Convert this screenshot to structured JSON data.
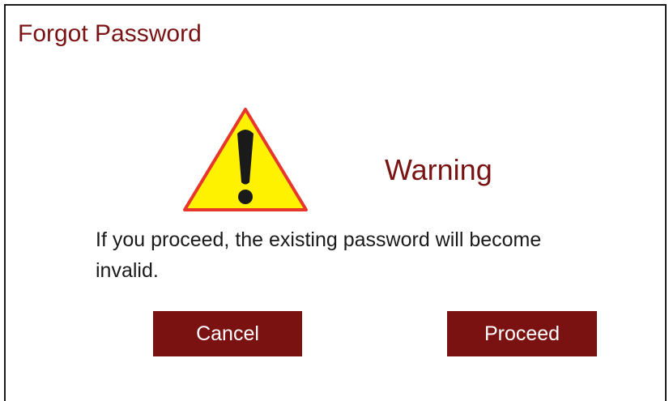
{
  "dialog": {
    "title": "Forgot Password",
    "warning_icon": "warning-triangle-icon",
    "heading": "Warning",
    "message": "If you proceed, the existing password will become invalid.",
    "buttons": {
      "cancel_label": "Cancel",
      "proceed_label": "Proceed"
    }
  },
  "colors": {
    "title_text": "#7a1414",
    "button_bg": "#7b1212",
    "button_text": "#ffffff",
    "icon_fill": "#fff200",
    "icon_outline": "#e8362c",
    "border": "#1a1a1a"
  }
}
